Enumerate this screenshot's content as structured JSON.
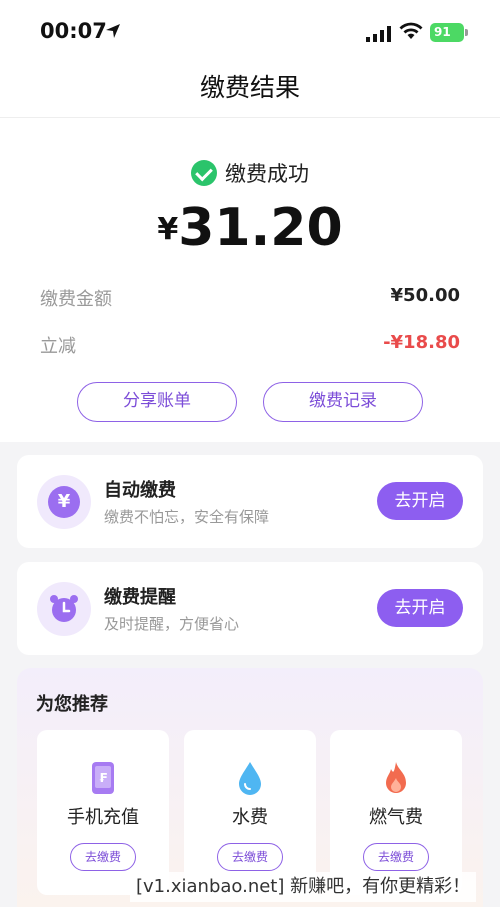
{
  "status_bar": {
    "time": "00:07",
    "battery": "91"
  },
  "nav": {
    "title": "缴费结果"
  },
  "result": {
    "status_text": "缴费成功",
    "currency": "¥",
    "amount": "31.20",
    "rows": [
      {
        "label": "缴费金额",
        "value": "¥50.00"
      },
      {
        "label": "立减",
        "value": "-¥18.80"
      }
    ],
    "share_label": "分享账单",
    "records_label": "缴费记录"
  },
  "cards": [
    {
      "icon": "yen-icon",
      "title": "自动缴费",
      "subtitle": "缴费不怕忘，安全有保障",
      "button": "去开启"
    },
    {
      "icon": "alarm-clock-icon",
      "title": "缴费提醒",
      "subtitle": "及时提醒，方便省心",
      "button": "去开启"
    }
  ],
  "recommend": {
    "title": "为您推荐",
    "tiles": [
      {
        "icon": "phone-recharge-icon",
        "label": "手机充值",
        "button": "去缴费"
      },
      {
        "icon": "water-drop-icon",
        "label": "水费",
        "button": "去缴费"
      },
      {
        "icon": "flame-icon",
        "label": "燃气费",
        "button": "去缴费"
      }
    ]
  },
  "watermark": "[v1.xianbao.net] 新赚吧，有你更精彩！",
  "colors": {
    "accent": "#8d5ef0",
    "success": "#2bc46b",
    "discount": "#e94b4b"
  }
}
